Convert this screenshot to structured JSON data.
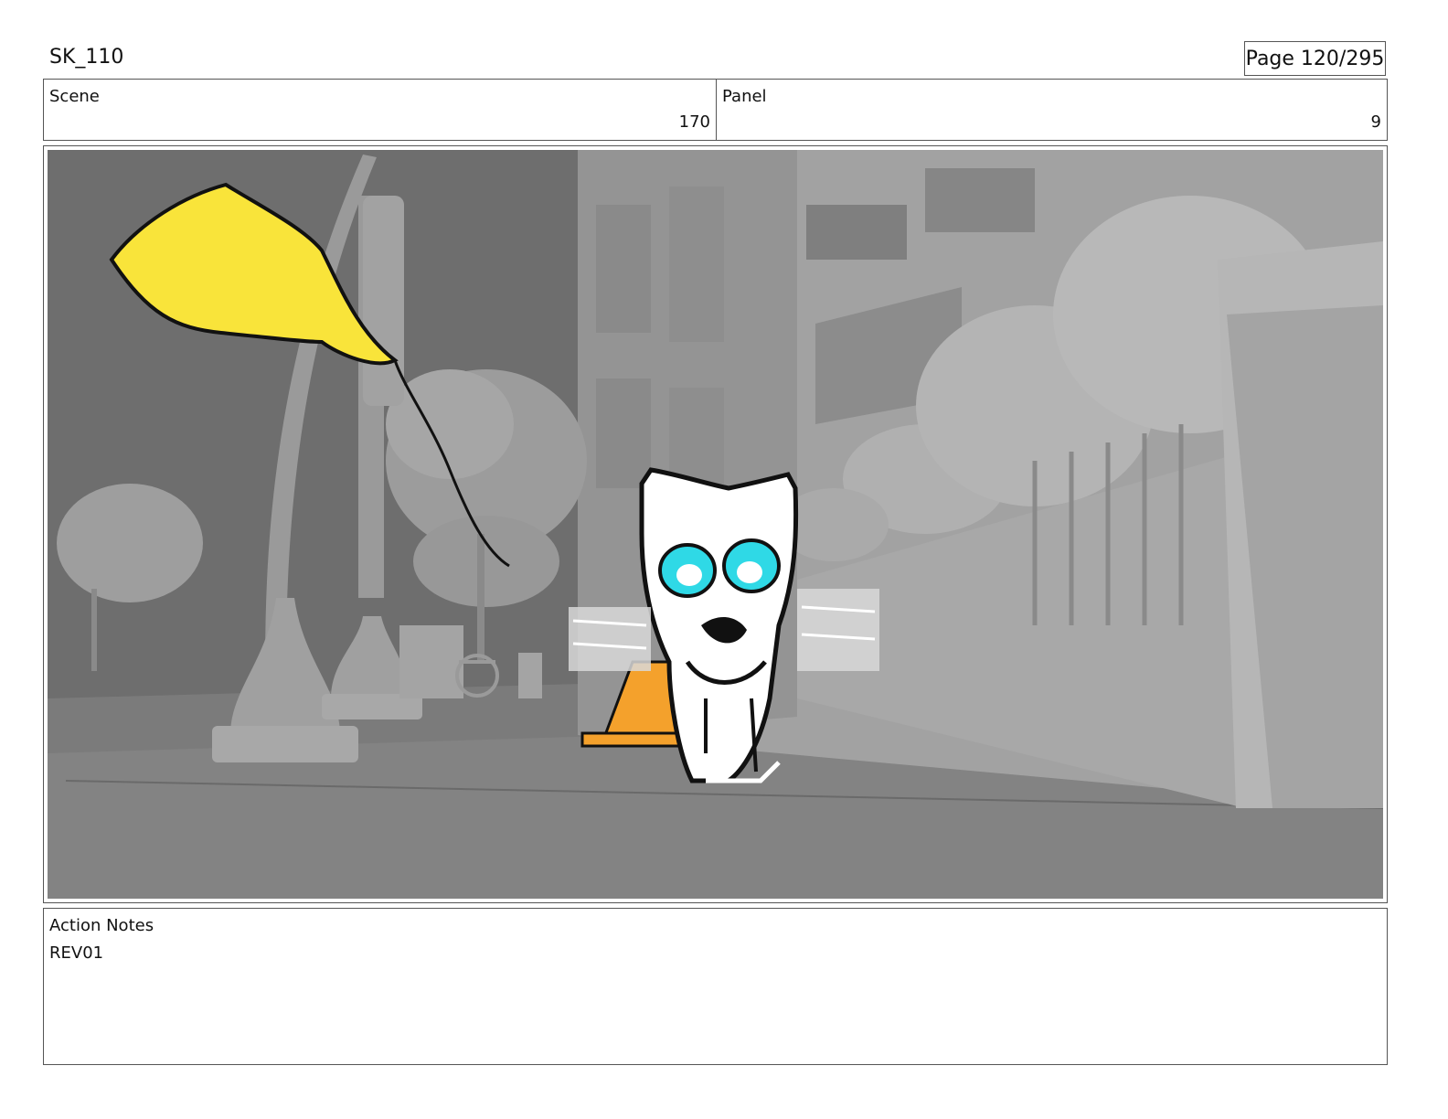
{
  "header": {
    "sheet_id": "SK_110",
    "page": "Page 120/295"
  },
  "scene": {
    "label": "Scene",
    "value": "170"
  },
  "panel": {
    "label": "Panel",
    "value": "9"
  },
  "notes": {
    "label": "Action Notes",
    "text": "REV01"
  },
  "illustration": {
    "description_icons": [
      "kite-icon",
      "street-lamp-icon",
      "tree-icon",
      "building-icon",
      "cat-character-icon",
      "traffic-cone-icon",
      "trash-can-icon",
      "bicycle-icon"
    ],
    "colors": {
      "kite": "#f9e43a",
      "cone": "#f4a12c",
      "eyes": "#2fd9e6",
      "background": "#6f6f6f"
    }
  }
}
